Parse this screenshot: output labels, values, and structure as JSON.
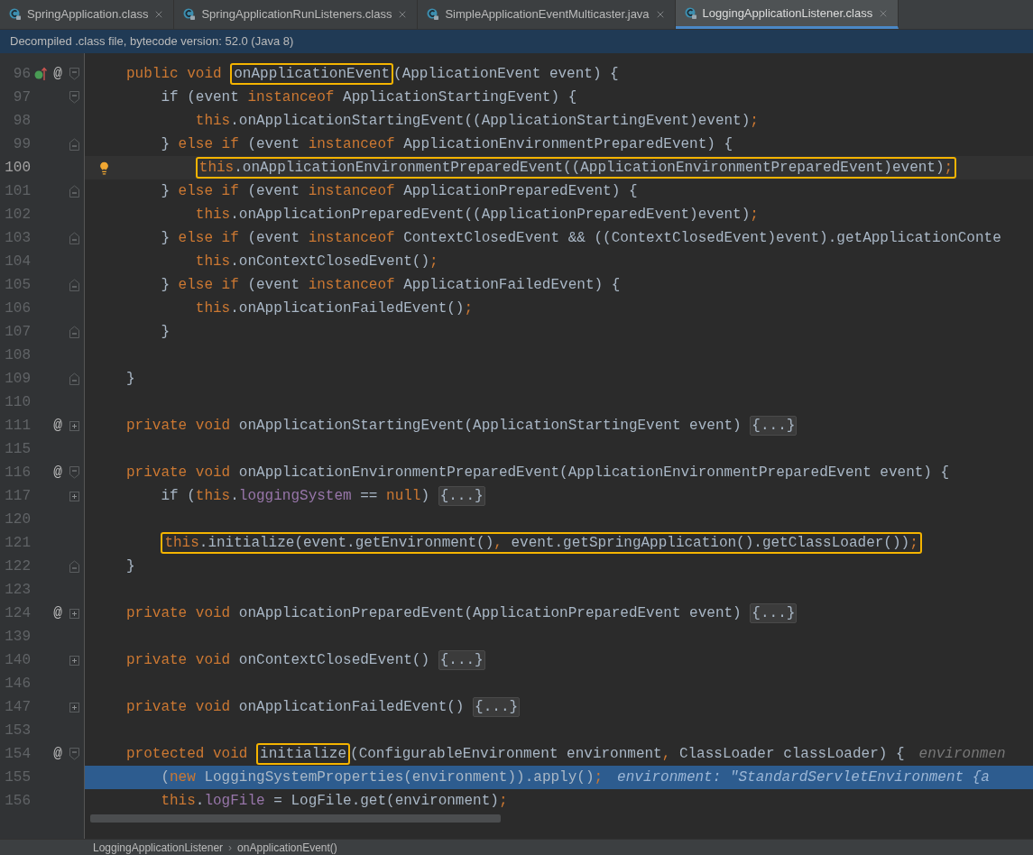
{
  "tabs": [
    {
      "label": "SpringApplication.class",
      "selected": false
    },
    {
      "label": "SpringApplicationRunListeners.class",
      "selected": false
    },
    {
      "label": "SimpleApplicationEventMulticaster.java",
      "selected": false
    },
    {
      "label": "LoggingApplicationListener.class",
      "selected": true
    }
  ],
  "banner": "Decompiled .class file, bytecode version: 52.0 (Java 8)",
  "lines": [
    {
      "number": "96",
      "marker": "@",
      "kind": "start",
      "caret": false,
      "paused": false,
      "code": [
        {
          "t": "public void ",
          "kind": "keyword"
        },
        {
          "kind": "box",
          "tokens": [
            {
              "t": "onApplicationEvent",
              "kind": "plain"
            }
          ]
        },
        {
          "t": "(ApplicationEvent event) {",
          "kind": "plain"
        }
      ],
      "children": [
        {
          "number": "97",
          "kind": "start",
          "caret": false,
          "paused": false,
          "code": [
            {
              "t": "if (event ",
              "kind": "plain"
            },
            {
              "t": "instanceof",
              "kind": "keyword"
            },
            {
              "t": " ApplicationStartingEvent) {",
              "kind": "plain"
            }
          ],
          "children": [
            {
              "number": "98",
              "caret": false,
              "paused": false,
              "code": [
                {
                  "t": "this",
                  "kind": "keyword"
                },
                {
                  "t": ".onApplicationStartingEvent((ApplicationStartingEvent)event)",
                  "kind": "plain"
                },
                {
                  "t": ";",
                  "kind": "keyword"
                }
              ]
            }
          ]
        },
        {
          "number": "99",
          "kind": "end",
          "caret": false,
          "paused": false,
          "code": [
            {
              "t": "} ",
              "kind": "plain"
            },
            {
              "t": "else if",
              "kind": "keyword"
            },
            {
              "t": " (event ",
              "kind": "plain"
            },
            {
              "t": "instanceof",
              "kind": "keyword"
            },
            {
              "t": " ApplicationEnvironmentPreparedEvent) {",
              "kind": "plain"
            }
          ],
          "children": [
            {
              "number": "100",
              "caret": true,
              "paused": false,
              "code": [
                {
                  "kind": "box",
                  "tokens": [
                    {
                      "t": "this",
                      "kind": "keyword"
                    },
                    {
                      "t": ".onApplicationEnvironmentPreparedEvent((ApplicationEnvironmentPreparedEvent)event)",
                      "kind": "plain"
                    },
                    {
                      "t": ";",
                      "kind": "keyword"
                    }
                  ]
                }
              ]
            }
          ]
        },
        {
          "number": "101",
          "kind": "end",
          "caret": false,
          "paused": false,
          "code": [
            {
              "t": "} ",
              "kind": "plain"
            },
            {
              "t": "else if",
              "kind": "keyword"
            },
            {
              "t": " (event ",
              "kind": "plain"
            },
            {
              "t": "instanceof",
              "kind": "keyword"
            },
            {
              "t": " ApplicationPreparedEvent) {",
              "kind": "plain"
            }
          ],
          "children": [
            {
              "number": "102",
              "caret": false,
              "paused": false,
              "code": [
                {
                  "t": "this",
                  "kind": "keyword"
                },
                {
                  "t": ".onApplicationPreparedEvent((ApplicationPreparedEvent)event)",
                  "kind": "plain"
                },
                {
                  "t": ";",
                  "kind": "keyword"
                }
              ]
            }
          ]
        },
        {
          "number": "103",
          "kind": "end",
          "caret": false,
          "paused": false,
          "code": [
            {
              "t": "} ",
              "kind": "plain"
            },
            {
              "t": "else if",
              "kind": "keyword"
            },
            {
              "t": " (event ",
              "kind": "plain"
            },
            {
              "t": "instanceof",
              "kind": "keyword"
            },
            {
              "t": " ContextClosedEvent && ((ContextClosedEvent)event).getApplicationConte",
              "kind": "plain"
            }
          ],
          "children": [
            {
              "number": "104",
              "caret": false,
              "paused": false,
              "code": [
                {
                  "t": "this",
                  "kind": "keyword"
                },
                {
                  "t": ".onContextClosedEvent()",
                  "kind": "plain"
                },
                {
                  "t": ";",
                  "kind": "keyword"
                }
              ]
            }
          ]
        },
        {
          "number": "105",
          "kind": "end",
          "caret": false,
          "paused": false,
          "code": [
            {
              "t": "} ",
              "kind": "plain"
            },
            {
              "t": "else if",
              "kind": "keyword"
            },
            {
              "t": " (event ",
              "kind": "plain"
            },
            {
              "t": "instanceof",
              "kind": "keyword"
            },
            {
              "t": " ApplicationFailedEvent) {",
              "kind": "plain"
            }
          ],
          "children": [
            {
              "number": "106",
              "caret": false,
              "paused": false,
              "code": [
                {
                  "t": "this",
                  "kind": "keyword"
                },
                {
                  "t": ".onApplicationFailedEvent()",
                  "kind": "plain"
                },
                {
                  "t": ";",
                  "kind": "keyword"
                }
              ]
            }
          ]
        },
        {
          "number": "107",
          "kind": "end",
          "caret": false,
          "paused": false,
          "code": [
            {
              "t": "}",
              "kind": "plain"
            }
          ]
        },
        {
          "number": "108",
          "caret": false,
          "paused": false
        }
      ]
    },
    {
      "number": "109",
      "kind": "end",
      "caret": false,
      "paused": false,
      "code": [
        {
          "t": "}",
          "kind": "plain"
        }
      ]
    },
    {
      "number": "110",
      "caret": false,
      "paused": false
    },
    {
      "number": "111",
      "marker": "@",
      "kind": "collapsed",
      "caret": false,
      "paused": false,
      "code": [
        {
          "t": "private void ",
          "kind": "keyword"
        },
        {
          "t": "onApplicationStartingEvent(ApplicationStartingEvent event) ",
          "kind": "plain"
        },
        {
          "t": "{...}",
          "kind": "folded"
        }
      ]
    },
    {
      "number": "115",
      "caret": false,
      "paused": false
    },
    {
      "number": "116",
      "marker": "@",
      "kind": "start",
      "caret": false,
      "paused": false,
      "code": [
        {
          "t": "private void ",
          "kind": "keyword"
        },
        {
          "t": "onApplicationEnvironmentPreparedEvent(ApplicationEnvironmentPreparedEvent event) {",
          "kind": "plain"
        }
      ],
      "children": [
        {
          "number": "117",
          "kind": "collapsed",
          "caret": false,
          "paused": false,
          "code": [
            {
              "t": "if (",
              "kind": "plain"
            },
            {
              "t": "this",
              "kind": "keyword"
            },
            {
              "t": ".",
              "kind": "plain"
            },
            {
              "t": "loggingSystem",
              "kind": "field"
            },
            {
              "t": " == ",
              "kind": "plain"
            },
            {
              "t": "null",
              "kind": "keyword"
            },
            {
              "t": ") ",
              "kind": "plain"
            },
            {
              "t": "{...}",
              "kind": "folded"
            }
          ]
        },
        {
          "number": "120",
          "caret": false,
          "paused": false
        },
        {
          "number": "121",
          "caret": false,
          "paused": false,
          "code": [
            {
              "kind": "box",
              "tokens": [
                {
                  "t": "this",
                  "kind": "keyword"
                },
                {
                  "t": ".initialize(event.getEnvironment()",
                  "kind": "plain"
                },
                {
                  "t": ",",
                  "kind": "keyword"
                },
                {
                  "t": " event.getSpringApplication().getClassLoader())",
                  "kind": "plain"
                },
                {
                  "t": ";",
                  "kind": "keyword"
                }
              ]
            }
          ]
        }
      ]
    },
    {
      "number": "122",
      "kind": "end",
      "caret": false,
      "paused": false,
      "code": [
        {
          "t": "}",
          "kind": "plain"
        }
      ]
    },
    {
      "number": "123",
      "caret": false,
      "paused": false
    },
    {
      "number": "124",
      "marker": "@",
      "kind": "collapsed",
      "caret": false,
      "paused": false,
      "code": [
        {
          "t": "private void ",
          "kind": "keyword"
        },
        {
          "t": "onApplicationPreparedEvent(ApplicationPreparedEvent event) ",
          "kind": "plain"
        },
        {
          "t": "{...}",
          "kind": "folded"
        }
      ]
    },
    {
      "number": "139",
      "caret": false,
      "paused": false
    },
    {
      "number": "140",
      "kind": "collapsed",
      "caret": false,
      "paused": false,
      "code": [
        {
          "t": "private void ",
          "kind": "keyword"
        },
        {
          "t": "onContextClosedEvent() ",
          "kind": "plain"
        },
        {
          "t": "{...}",
          "kind": "folded"
        }
      ]
    },
    {
      "number": "146",
      "caret": false,
      "paused": false
    },
    {
      "number": "147",
      "kind": "collapsed",
      "caret": false,
      "paused": false,
      "code": [
        {
          "t": "private void ",
          "kind": "keyword"
        },
        {
          "t": "onApplicationFailedEvent() ",
          "kind": "plain"
        },
        {
          "t": "{...}",
          "kind": "folded"
        }
      ]
    },
    {
      "number": "153",
      "caret": false,
      "paused": false
    },
    {
      "number": "154",
      "marker": "@",
      "kind": "start",
      "caret": false,
      "paused": false,
      "code": [
        {
          "t": "protected void ",
          "kind": "keyword"
        },
        {
          "kind": "box",
          "tokens": [
            {
              "t": "initialize",
              "kind": "plain"
            }
          ]
        },
        {
          "t": "(ConfigurableEnvironment environment",
          "kind": "plain"
        },
        {
          "t": ",",
          "kind": "keyword"
        },
        {
          "t": " ClassLoader classLoader) {",
          "kind": "plain"
        },
        {
          "t": "environmen",
          "kind": "hint"
        }
      ],
      "children": [
        {
          "number": "155",
          "caret": false,
          "paused": true,
          "code": [
            {
              "t": "(",
              "kind": "plain"
            },
            {
              "t": "new",
              "kind": "keyword"
            },
            {
              "t": " LoggingSystemProperties(environment)).apply()",
              "kind": "plain"
            },
            {
              "t": ";",
              "kind": "keyword"
            },
            {
              "t": "environment: \"StandardServletEnvironment {a",
              "kind": "hint"
            }
          ]
        },
        {
          "number": "156",
          "caret": false,
          "paused": false,
          "code": [
            {
              "t": "this",
              "kind": "keyword"
            },
            {
              "t": ".",
              "kind": "plain"
            },
            {
              "t": "logFile",
              "kind": "field"
            },
            {
              "t": " = LogFile.get(environment)",
              "kind": "plain"
            },
            {
              "t": ";",
              "kind": "keyword"
            }
          ]
        }
      ]
    }
  ],
  "breadcrumb": [
    "LoggingApplicationListener",
    "onApplicationEvent()"
  ],
  "breadcrumb_separator": "›"
}
